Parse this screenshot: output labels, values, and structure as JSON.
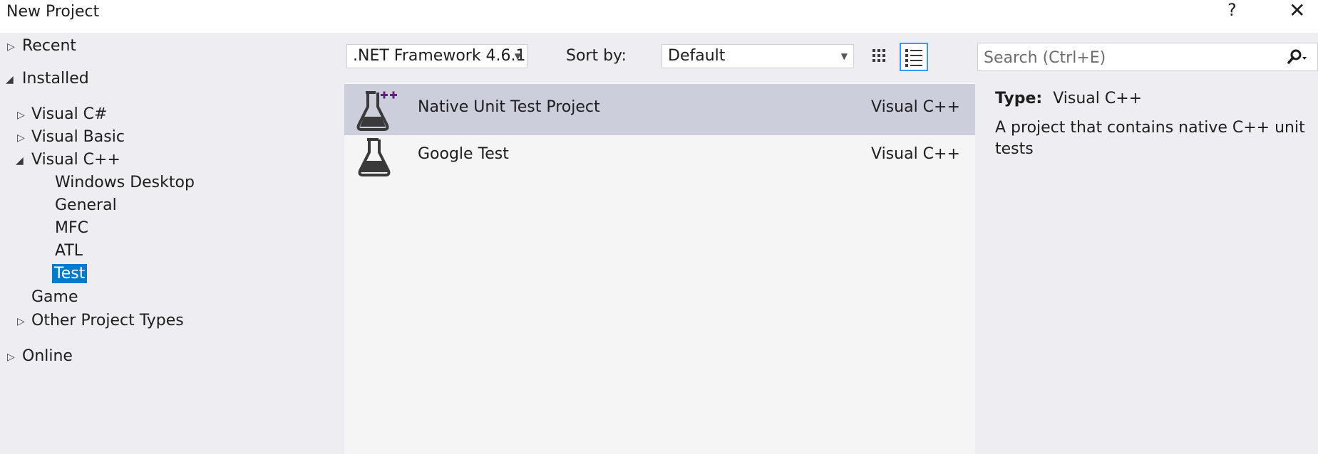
{
  "window": {
    "title": "New Project",
    "help": "?",
    "close": "✕"
  },
  "tree": {
    "recent": "Recent",
    "installed": "Installed",
    "visual_csharp": "Visual C#",
    "visual_basic": "Visual Basic",
    "visual_cpp": "Visual C++",
    "windows_desktop": "Windows Desktop",
    "general": "General",
    "mfc": "MFC",
    "atl": "ATL",
    "test": "Test",
    "game": "Game",
    "other_project_types": "Other Project Types",
    "online": "Online"
  },
  "filters": {
    "framework": ".NET Framework 4.6.1",
    "sort_label": "Sort by:",
    "sort_value": "Default"
  },
  "templates": [
    {
      "name": "Native Unit Test Project",
      "language": "Visual C++"
    },
    {
      "name": "Google Test",
      "language": "Visual C++"
    }
  ],
  "search": {
    "placeholder": "Search (Ctrl+E)"
  },
  "details": {
    "type_label": "Type:",
    "type_value": "Visual C++",
    "description": "A project that contains native C++ unit tests"
  },
  "colors": {
    "accent": "#007acc",
    "selected_row": "#cccedb",
    "flask": "#3a3a3a",
    "plus_badge": "#68217a"
  }
}
